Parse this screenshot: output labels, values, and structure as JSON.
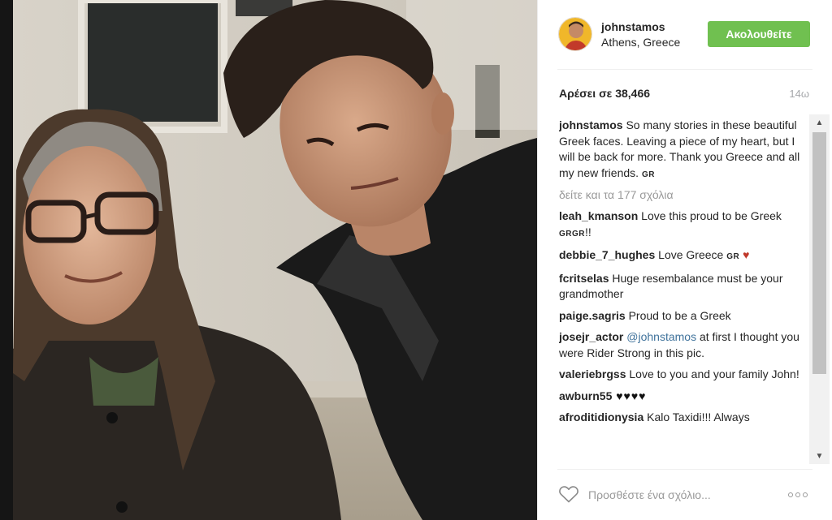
{
  "post": {
    "username": "johnstamos",
    "location": "Athens, Greece",
    "follow_label": "Ακολουθείτε",
    "likes": "Αρέσει σε 38,466",
    "time_ago": "14ω",
    "caption": {
      "user": "johnstamos",
      "text": " So many stories in these beautiful Greek faces. Leaving a piece of my heart, but I will be back for more. Thank you Greece and all my new friends. ",
      "flag": "GR"
    },
    "load_more": "δείτε και τα 177 σχόλια",
    "comments": [
      {
        "user": "leah_kmanson",
        "text": " Love this proud to be Greek ",
        "flag": "GRGR",
        "suffix": "!!"
      },
      {
        "user": "debbie_7_hughes",
        "text": " Love Greece ",
        "flag": "GR",
        "heart": "♥"
      },
      {
        "user": "fcritselas",
        "text": " Huge resembalance must be your grandmother"
      },
      {
        "user": "paige.sagris",
        "text": " Proud to be a Greek"
      },
      {
        "user": "josejr_actor",
        "mention": " @johnstamos",
        "text": " at first I thought you were Rider Strong in this pic."
      },
      {
        "user": "valeriebrgss",
        "text": " Love to you and your family John!"
      },
      {
        "user": "awburn55",
        "hearts": " ♥♥♥♥"
      },
      {
        "user": "afroditidionysia",
        "text": " Kalo Taxidi!!! Always"
      }
    ],
    "add_comment_placeholder": "Προσθέστε ένα σχόλιο...",
    "icons": {
      "like": "heart-outline-icon",
      "more": "more-options-icon",
      "scroll_up": "scroll-up-arrow-icon",
      "scroll_down": "scroll-down-arrow-icon"
    },
    "colors": {
      "follow_button": "#70c050",
      "mention": "#3f729b",
      "muted": "#999999",
      "heart": "#c0392b"
    }
  }
}
